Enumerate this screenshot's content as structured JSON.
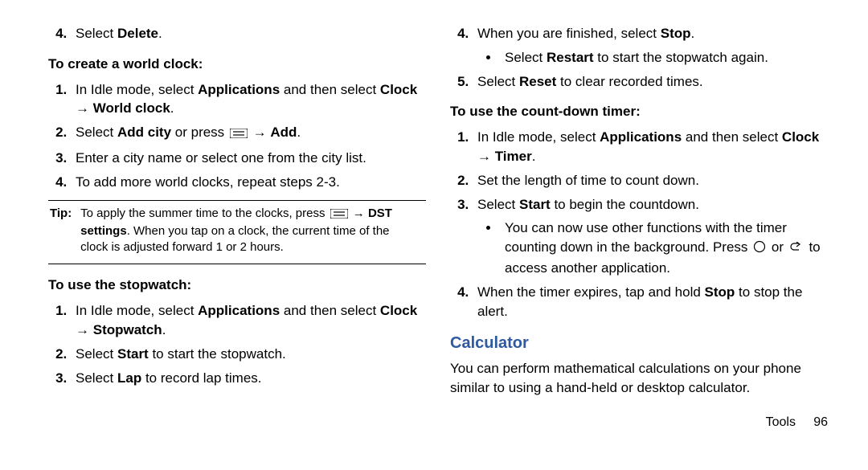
{
  "left": {
    "topItemText": "Select ",
    "topItemBold": "Delete",
    "topItemTail": ".",
    "h_create": "To create a world clock:",
    "c1a": "In Idle mode, select ",
    "c1b": "Applications",
    "c1c": " and then select ",
    "c1d": "Clock",
    "c1e": " → ",
    "c1f": "World clock",
    "c1g": ".",
    "c2a": "Select ",
    "c2b": "Add city",
    "c2c": " or press ",
    "c2d": " → ",
    "c2e": "Add",
    "c2f": ".",
    "c3": "Enter a city name or select one from the city list.",
    "c4": "To add more world clocks, repeat steps 2-3.",
    "tip_label": "Tip:",
    "tip_a": "To apply the summer time to the clocks, press ",
    "tip_b": " → ",
    "tip_c": "DST settings",
    "tip_d": ". When you tap on a clock, the current time of the clock is adjusted forward 1 or 2 hours.",
    "h_stopwatch": "To use the stopwatch:",
    "s1a": "In Idle mode, select ",
    "s1b": "Applications",
    "s1c": " and then select ",
    "s1d": "Clock",
    "s1e": " → ",
    "s1f": "Stopwatch",
    "s1g": ".",
    "s2a": "Select ",
    "s2b": "Start",
    "s2c": " to start the stopwatch.",
    "s3a": "Select ",
    "s3b": "Lap",
    "s3c": " to record lap times."
  },
  "right": {
    "s4a": "When you are finished, select ",
    "s4b": "Stop",
    "s4c": ".",
    "s4sub_a": "Select ",
    "s4sub_b": "Restart",
    "s4sub_c": " to start the stopwatch again.",
    "s5a": "Select ",
    "s5b": "Reset",
    "s5c": " to clear recorded times.",
    "h_timer": "To use the count-down timer:",
    "t1a": "In Idle mode, select ",
    "t1b": "Applications",
    "t1c": " and then select ",
    "t1d": "Clock",
    "t1e": " → ",
    "t1f": "Timer",
    "t1g": ".",
    "t2": "Set the length of time to count down.",
    "t3a": "Select ",
    "t3b": "Start",
    "t3c": " to begin the countdown.",
    "t3sub_a": "You can now use other functions with the timer counting down in the background. Press ",
    "t3sub_b": " or ",
    "t3sub_c": " to access another application.",
    "t4a": "When the timer expires, tap and hold ",
    "t4b": "Stop",
    "t4c": " to stop the alert.",
    "calc_title": "Calculator",
    "calc_body": "You can perform mathematical calculations on your phone similar to using a hand-held or desktop calculator.",
    "footer_section": "Tools",
    "footer_page": "96"
  }
}
